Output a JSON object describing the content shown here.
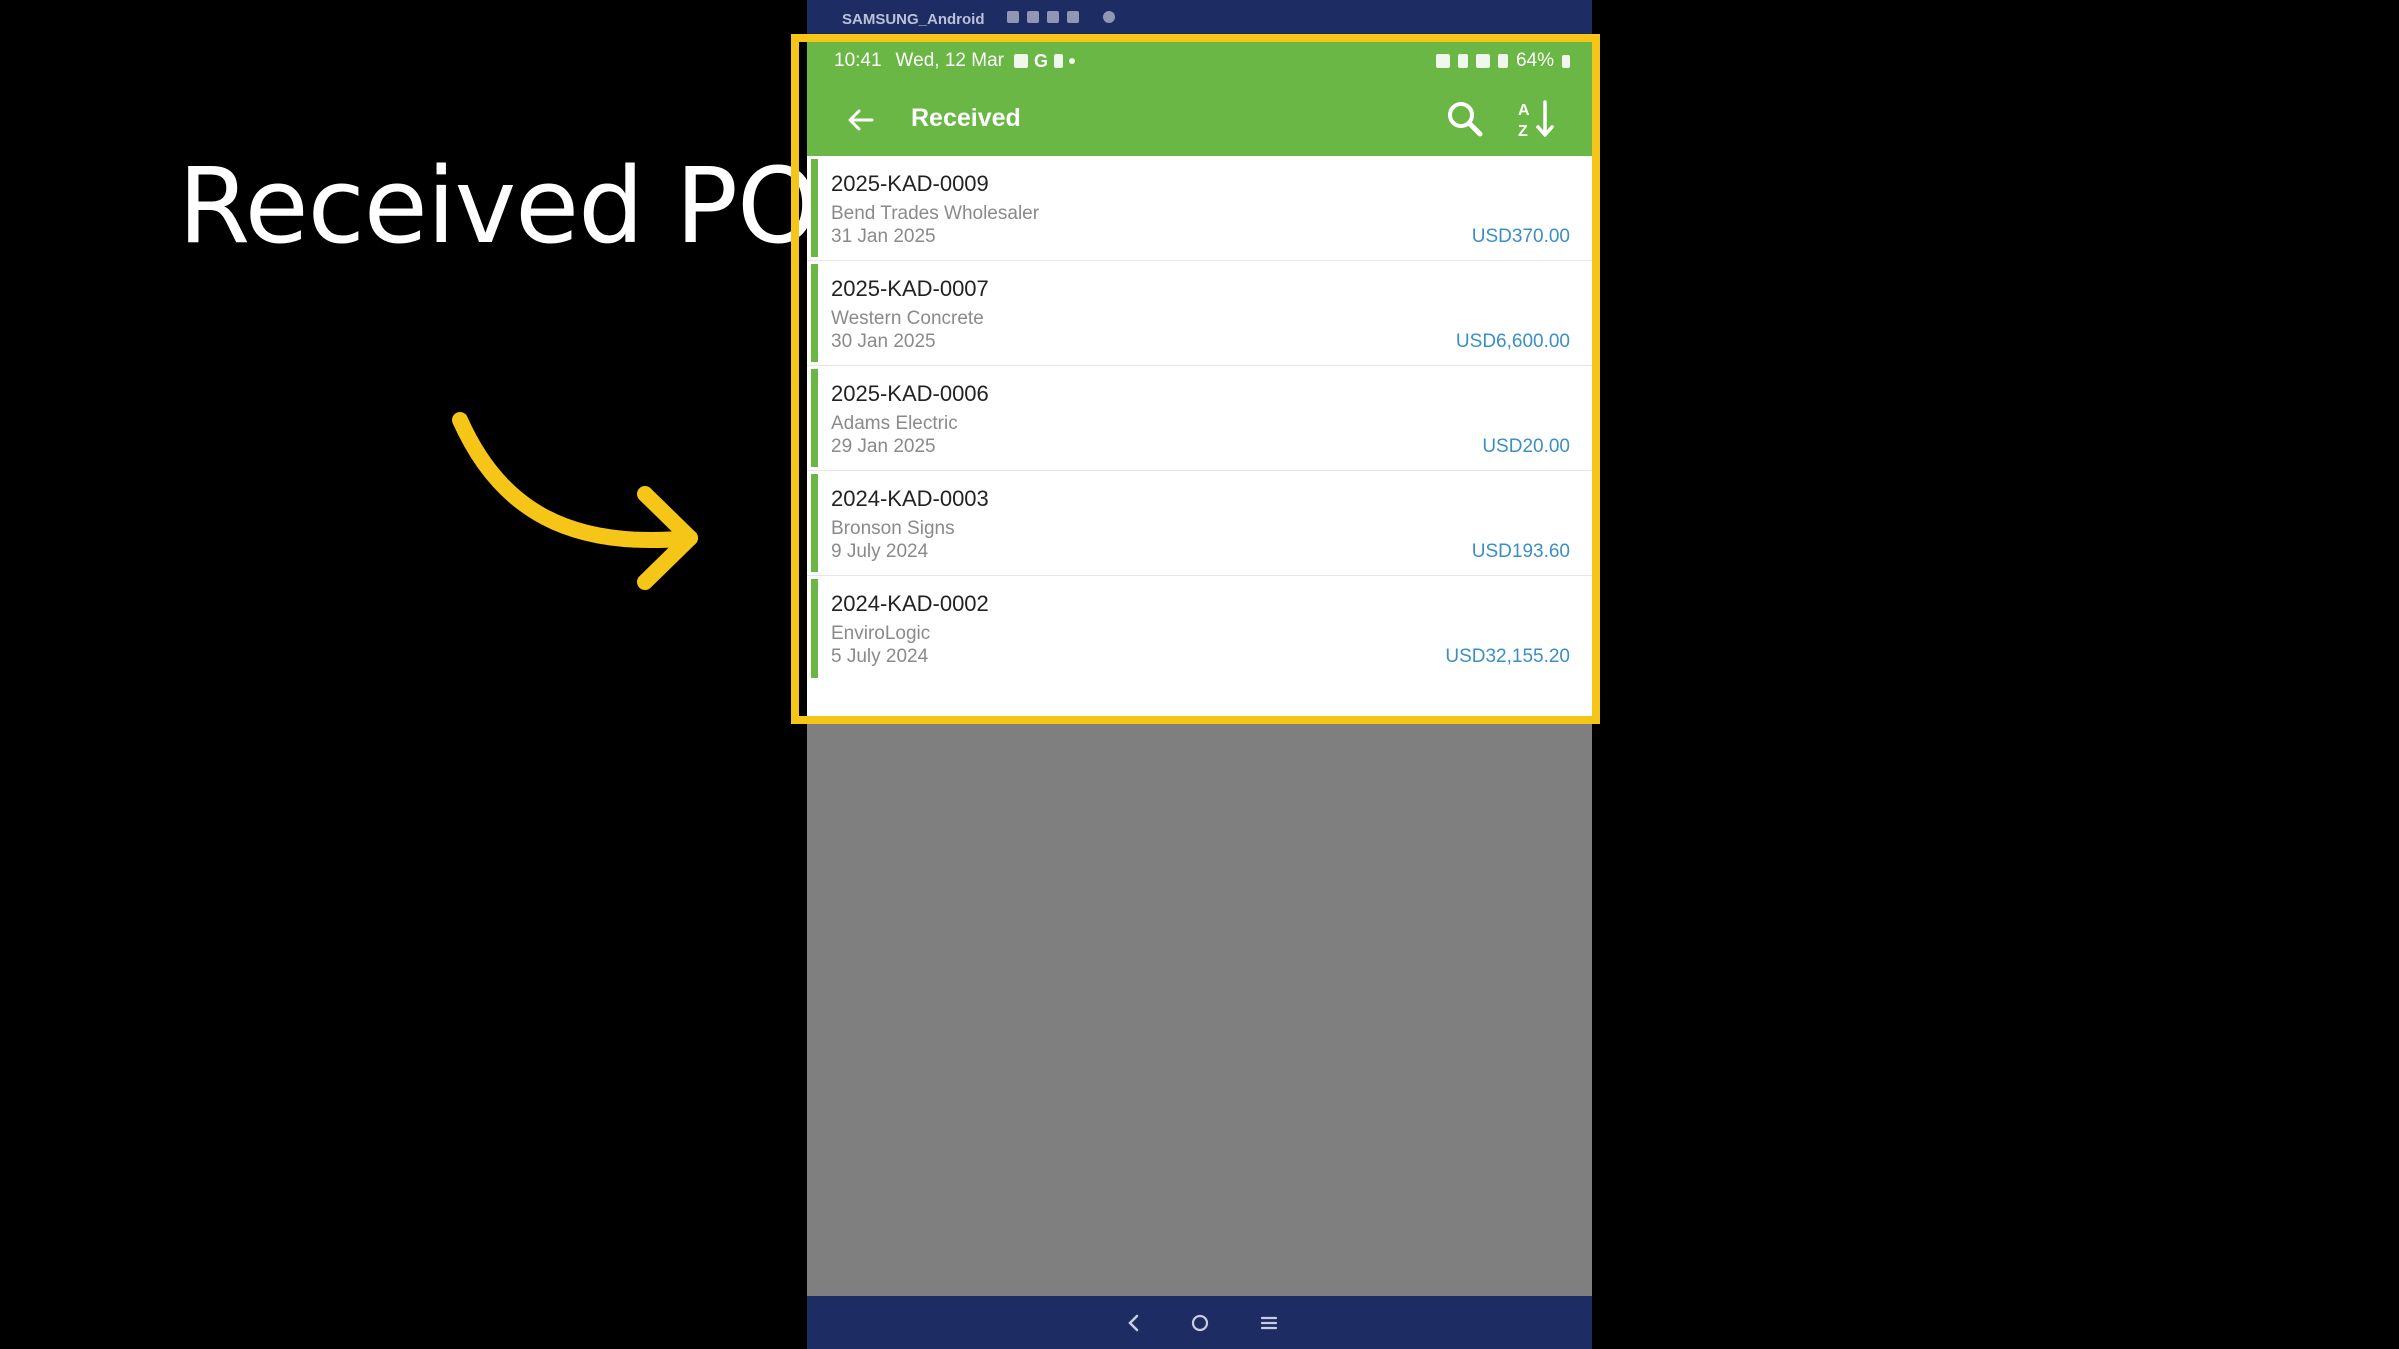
{
  "overlay": {
    "headline": "Received POs",
    "highlight_color": "#f5c518",
    "arrow_color": "#f5c518"
  },
  "device": {
    "name": "SAMSUNG_Android"
  },
  "status_bar": {
    "time": "10:41",
    "date": "Wed, 12 Mar",
    "g_label": "G",
    "battery": "64%"
  },
  "app_bar": {
    "title": "Received",
    "color": "#6ab745",
    "icons": [
      "back-arrow-icon",
      "search-icon",
      "sort-az-icon"
    ]
  },
  "orders": [
    {
      "number": "2025-KAD-0009",
      "vendor": "Bend Trades Wholesaler",
      "date": "31 Jan 2025",
      "amount": "USD370.00"
    },
    {
      "number": "2025-KAD-0007",
      "vendor": "Western Concrete",
      "date": "30 Jan 2025",
      "amount": "USD6,600.00"
    },
    {
      "number": "2025-KAD-0006",
      "vendor": "Adams Electric",
      "date": "29 Jan 2025",
      "amount": "USD20.00"
    },
    {
      "number": "2024-KAD-0003",
      "vendor": "Bronson Signs",
      "date": "9 July 2024",
      "amount": "USD193.60"
    },
    {
      "number": "2024-KAD-0002",
      "vendor": "EnviroLogic",
      "date": "5 July 2024",
      "amount": "USD32,155.20"
    }
  ],
  "nav_bar": {
    "icons": [
      "back-nav-icon",
      "home-nav-icon",
      "recents-nav-icon"
    ]
  }
}
